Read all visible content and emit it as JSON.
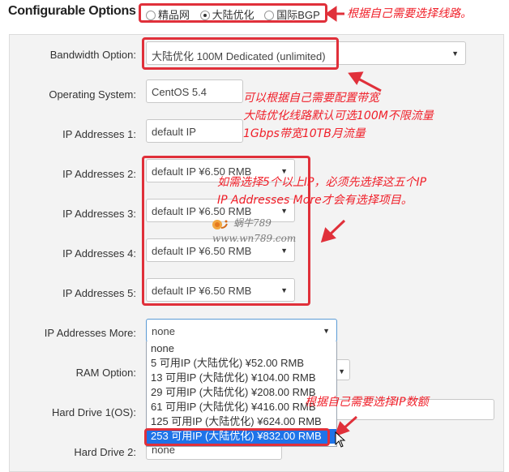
{
  "section_title": "Configurable Options",
  "route_options": [
    {
      "label": "精品网",
      "selected": false
    },
    {
      "label": "大陆优化",
      "selected": true
    },
    {
      "label": "国际BGP",
      "selected": false
    }
  ],
  "fields": {
    "bandwidth": {
      "label": "Bandwidth Option:",
      "value": "大陆优化 100M Dedicated (unlimited)"
    },
    "os": {
      "label": "Operating System:",
      "value": "CentOS 5.4"
    },
    "ip1": {
      "label": "IP Addresses 1:",
      "value": "default IP"
    },
    "ip2": {
      "label": "IP Addresses 2:",
      "value": "default IP ¥6.50 RMB"
    },
    "ip3": {
      "label": "IP Addresses 3:",
      "value": "default IP ¥6.50 RMB"
    },
    "ip4": {
      "label": "IP Addresses 4:",
      "value": "default IP ¥6.50 RMB"
    },
    "ip5": {
      "label": "IP Addresses 5:",
      "value": "default IP ¥6.50 RMB"
    },
    "ip_more": {
      "label": "IP Addresses More:",
      "value": "none"
    },
    "ram": {
      "label": "RAM Option:"
    },
    "hd1": {
      "label": "Hard Drive 1(OS):"
    },
    "hd2": {
      "label": "Hard Drive 2:",
      "value": "none"
    }
  },
  "ip_more_options": [
    "none",
    "5 可用IP (大陆优化) ¥52.00 RMB",
    "13 可用IP (大陆优化) ¥104.00 RMB",
    "29 可用IP (大陆优化) ¥208.00 RMB",
    "61 可用IP (大陆优化) ¥416.00 RMB",
    "125 可用IP (大陆优化) ¥624.00 RMB",
    "253 可用IP (大陆优化) ¥832.00 RMB"
  ],
  "annotations": {
    "route": "根据自己需要选择线路。",
    "bandwidth_1": "可以根据自己需要配置带宽",
    "bandwidth_2": "大陆优化线路默认可选100M不限流量",
    "bandwidth_3": "1Gbps带宽10TB月流量",
    "ip_1": "如需选择5个以上IP，必须先选择这五个IP",
    "ip_2": "IP Addresses More才会有选择项目。",
    "ip_count": "根据自己需要选择IP数额"
  },
  "watermark": {
    "name": "蜗牛789",
    "url": "www.wn789.com"
  },
  "colors": {
    "annotation_red": "#e0303a",
    "highlight_blue": "#1e73e8"
  }
}
